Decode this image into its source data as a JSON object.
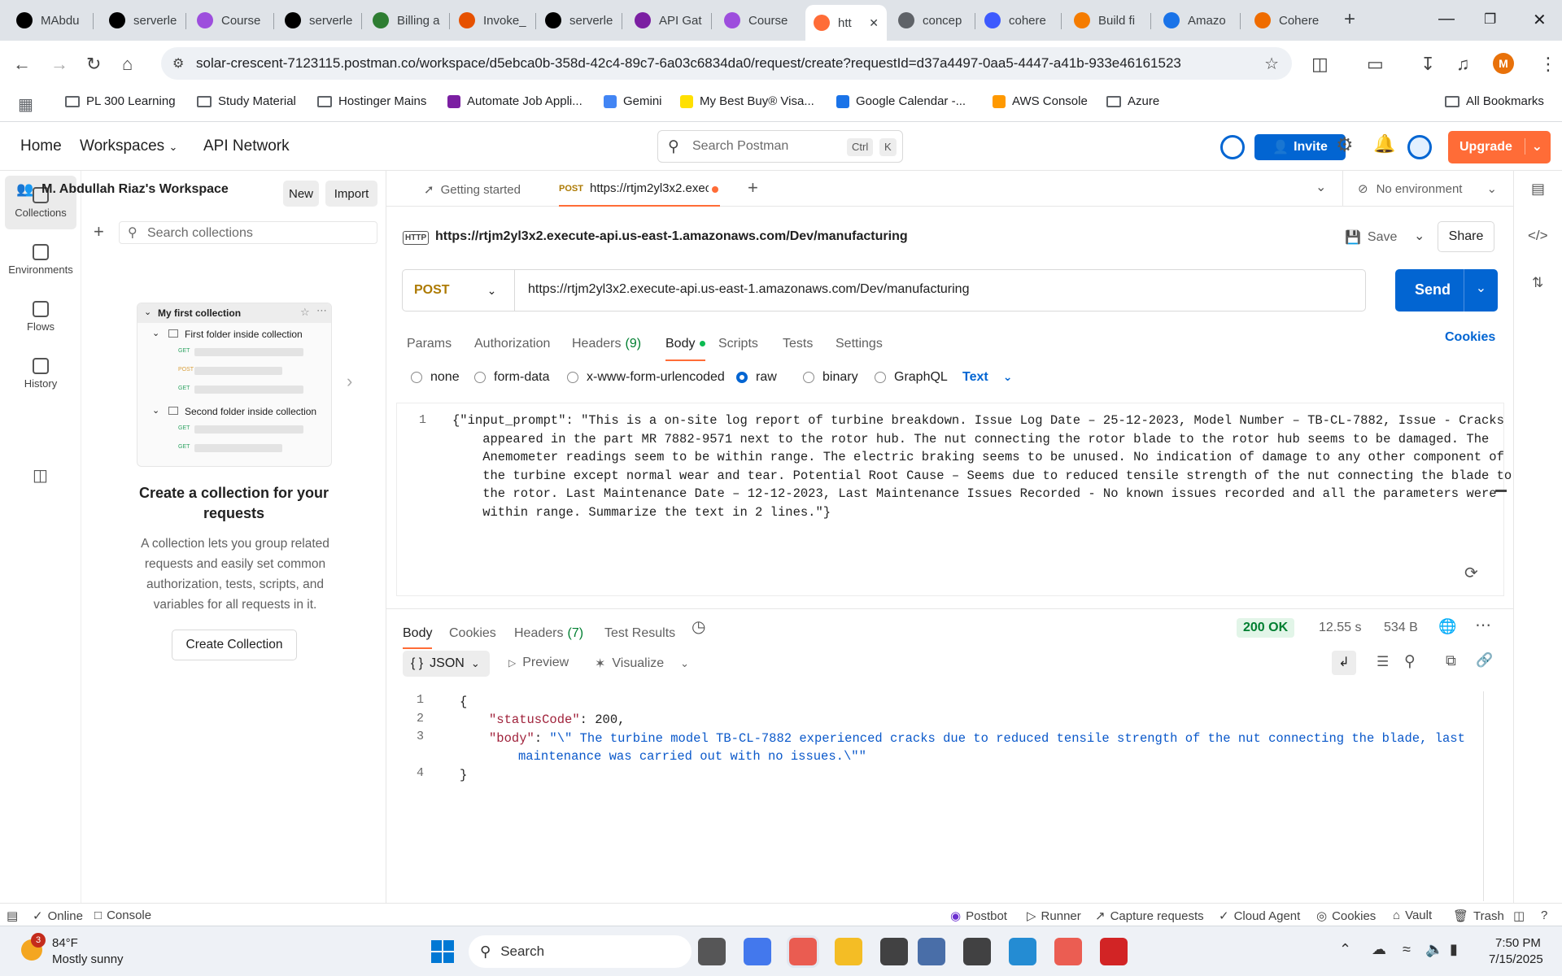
{
  "browser": {
    "tabs": [
      {
        "label": "MAbdu",
        "icon": "github-icon",
        "color": "#000000"
      },
      {
        "label": "serverle",
        "icon": "github-icon",
        "color": "#000000"
      },
      {
        "label": "Course",
        "icon": "course-icon",
        "color": "#9d4edd"
      },
      {
        "label": "serverle",
        "icon": "github-icon",
        "color": "#000000"
      },
      {
        "label": "Billing a",
        "icon": "billing-icon",
        "color": "#2e7d32"
      },
      {
        "label": "Invoke_",
        "icon": "aws-icon",
        "color": "#e65100"
      },
      {
        "label": "serverle",
        "icon": "github-icon",
        "color": "#000000"
      },
      {
        "label": "API Gat",
        "icon": "api-gateway-icon",
        "color": "#7b1fa2"
      },
      {
        "label": "Course",
        "icon": "course-icon",
        "color": "#9d4edd"
      },
      {
        "label": "htt",
        "icon": "postman-icon",
        "color": "#ff6c37",
        "active": true
      },
      {
        "label": "concep",
        "icon": "concept-icon",
        "color": "#5f6368"
      },
      {
        "label": "cohere",
        "icon": "cohere-icon",
        "color": "#3d5afe"
      },
      {
        "label": "Build fi",
        "icon": "bedrock-icon",
        "color": "#f57c00"
      },
      {
        "label": "Amazo",
        "icon": "amazon-icon",
        "color": "#1a73e8"
      },
      {
        "label": "Cohere",
        "icon": "cohere-box-icon",
        "color": "#ef6c00"
      }
    ],
    "url": "solar-crescent-7123115.postman.co/workspace/d5ebca0b-358d-42c4-89c7-6a03c6834da0/request/create?requestId=d37a4497-0aa5-4447-a41b-933e46161523",
    "profile_initial": "M",
    "bookmarks": [
      {
        "label": "PL 300 Learning",
        "icon": "folder-icon"
      },
      {
        "label": "Study Material",
        "icon": "folder-icon"
      },
      {
        "label": "Hostinger Mains",
        "icon": "folder-icon"
      },
      {
        "label": "Automate Job Appli...",
        "icon": "automate-icon"
      },
      {
        "label": "Gemini",
        "icon": "gemini-icon"
      },
      {
        "label": "My Best Buy® Visa...",
        "icon": "bestbuy-icon"
      },
      {
        "label": "Google Calendar -...",
        "icon": "calendar-icon"
      },
      {
        "label": "AWS Console",
        "icon": "aws-icon"
      },
      {
        "label": "Azure",
        "icon": "folder-icon"
      }
    ],
    "all_bookmarks": "All Bookmarks"
  },
  "postman_header": {
    "home": "Home",
    "workspaces": "Workspaces",
    "api_network": "API Network",
    "search_placeholder": "Search Postman",
    "kbd_ctrl": "Ctrl",
    "kbd_k": "K",
    "invite": "Invite",
    "upgrade": "Upgrade"
  },
  "sidebar": {
    "workspace_name": "M. Abdullah Riaz's Workspace",
    "new_label": "New",
    "import_label": "Import",
    "search_placeholder": "Search collections",
    "nav": [
      {
        "label": "Collections",
        "icon": "collections-icon"
      },
      {
        "label": "Environments",
        "icon": "environments-icon"
      },
      {
        "label": "Flows",
        "icon": "flows-icon"
      },
      {
        "label": "History",
        "icon": "history-icon"
      }
    ],
    "preview": {
      "title": "My first collection",
      "folder1": "First folder inside collection",
      "folder2": "Second folder inside collection",
      "methods1": [
        "GET",
        "POST",
        "GET"
      ],
      "methods2": [
        "GET",
        "GET"
      ]
    },
    "empty_title": "Create a collection for your requests",
    "empty_desc": "A collection lets you group related requests and easily set common authorization, tests, scripts, and variables for all requests in it.",
    "create_button": "Create Collection"
  },
  "request_tabs": {
    "getting_started": "Getting started",
    "active_method": "POST",
    "active_url": "https://rtjm2yl3x2.exec",
    "environment": "No environment"
  },
  "request": {
    "title": "https://rtjm2yl3x2.execute-api.us-east-1.amazonaws.com/Dev/manufacturing",
    "http_badge": "HTTP",
    "save": "Save",
    "share": "Share",
    "method": "POST",
    "url": "https://rtjm2yl3x2.execute-api.us-east-1.amazonaws.com/Dev/manufacturing",
    "send": "Send",
    "tabs": [
      "Params",
      "Authorization",
      "Headers",
      "Body",
      "Scripts",
      "Tests",
      "Settings"
    ],
    "headers_count": "(9)",
    "cookies": "Cookies",
    "body_types": [
      "none",
      "form-data",
      "x-www-form-urlencoded",
      "raw",
      "binary",
      "GraphQL"
    ],
    "body_format": "Text",
    "body_line_no": "1",
    "body_lines": [
      "{\"input_prompt\": \"This is a on-site log report of turbine breakdown. Issue Log Date – 25-12-2023, Model Number – TB-CL-7882, Issue - Cracks",
      "    appeared in the part MR 7882-9571 next to the rotor hub. The nut connecting the rotor blade to the rotor hub seems to be damaged. The",
      "    Anemometer readings seem to be within range. The electric braking seems to be unused. No indication of damage to any other component of",
      "    the turbine except normal wear and tear. Potential Root Cause – Seems due to reduced tensile strength of the nut connecting the blade to",
      "    the rotor. Last Maintenance Date – 12-12-2023, Last Maintenance Issues Recorded - No known issues recorded and all the parameters were",
      "    within range. Summarize the text in 2 lines.\"}"
    ]
  },
  "response": {
    "tabs": [
      "Body",
      "Cookies",
      "Headers",
      "Test Results"
    ],
    "headers_count": "(7)",
    "status": "200 OK",
    "time": "12.55 s",
    "size": "534 B",
    "format": "JSON",
    "preview": "Preview",
    "visualize": "Visualize",
    "line_numbers": [
      "1",
      "2",
      "3",
      "",
      "4"
    ],
    "open_brace": "{",
    "status_key": "\"statusCode\"",
    "status_val": "200",
    "body_key": "\"body\"",
    "body_val_1": "\"\\\" The turbine model TB-CL-7882 experienced cracks due to reduced tensile strength of the nut connecting the blade, last",
    "body_val_2": "maintenance was carried out with no issues.\\\"\"",
    "close_brace": "}"
  },
  "statusbar": {
    "online": "Online",
    "console": "Console",
    "postbot": "Postbot",
    "runner": "Runner",
    "capture": "Capture requests",
    "cloud_agent": "Cloud Agent",
    "cookies": "Cookies",
    "vault": "Vault",
    "trash": "Trash"
  },
  "taskbar": {
    "weather_temp": "84°F",
    "weather_desc": "Mostly sunny",
    "weather_badge": "3",
    "search": "Search",
    "time": "7:50 PM",
    "date": "7/15/2025"
  },
  "colors": {
    "postman_orange": "#ff6c37",
    "postman_blue": "#0265d2",
    "status_green": "#007f31",
    "json_key": "#a0223b",
    "json_string": "#0a58ca"
  }
}
